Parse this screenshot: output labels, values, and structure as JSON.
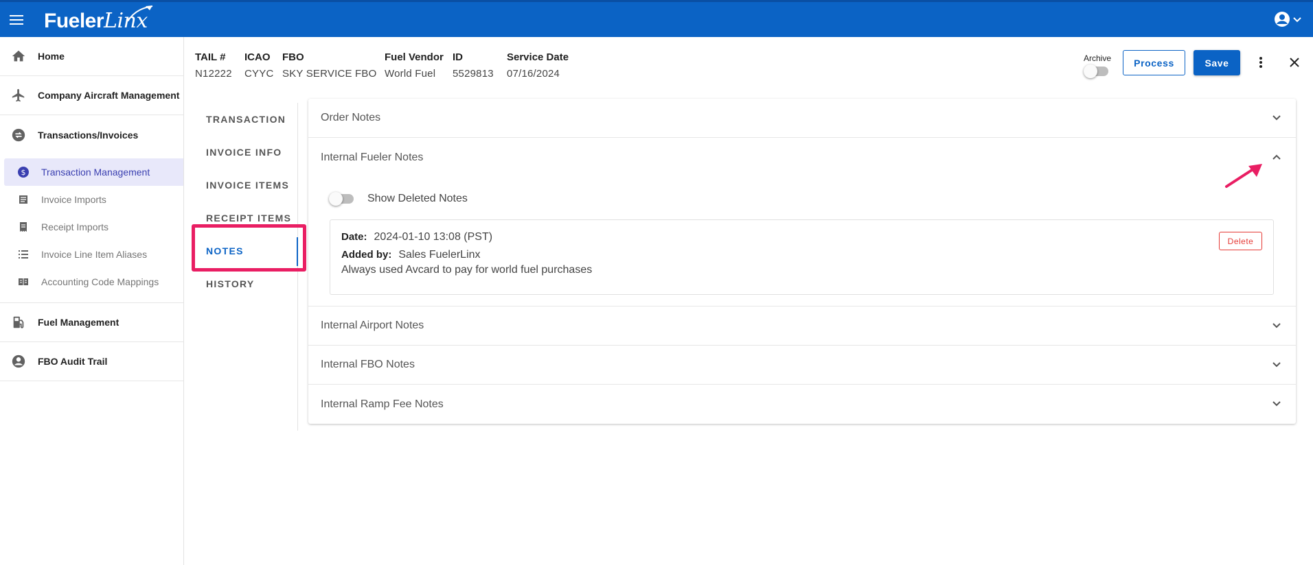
{
  "app": {
    "logo_main": "Fueler",
    "logo_accent": "Linx"
  },
  "sidebar": {
    "items": [
      {
        "label": "Home",
        "icon": "home-icon"
      },
      {
        "label": "Company Aircraft Management",
        "icon": "airplane-icon"
      },
      {
        "label": "Transactions/Invoices",
        "icon": "swap-icon"
      }
    ],
    "sub_items": [
      {
        "label": "Transaction Management",
        "icon": "dollar-circle-icon",
        "active": true
      },
      {
        "label": "Invoice Imports",
        "icon": "document-icon"
      },
      {
        "label": "Receipt Imports",
        "icon": "receipt-icon"
      },
      {
        "label": "Invoice Line Item Aliases",
        "icon": "list-icon"
      },
      {
        "label": "Accounting Code Mappings",
        "icon": "book-icon"
      }
    ],
    "bottom_items": [
      {
        "label": "Fuel Management",
        "icon": "fuel-pump-icon"
      },
      {
        "label": "FBO Audit Trail",
        "icon": "account-circle-icon"
      }
    ]
  },
  "header": {
    "fields": [
      {
        "label": "TAIL #",
        "value": "N12222"
      },
      {
        "label": "ICAO",
        "value": "CYYC"
      },
      {
        "label": "FBO",
        "value": "SKY SERVICE FBO"
      },
      {
        "label": "Fuel Vendor",
        "value": "World Fuel"
      },
      {
        "label": "ID",
        "value": "5529813"
      },
      {
        "label": "Service Date",
        "value": "07/16/2024"
      }
    ],
    "archive_label": "Archive",
    "archive_on": false,
    "process_label": "Process",
    "save_label": "Save"
  },
  "tabs": [
    {
      "label": "TRANSACTION"
    },
    {
      "label": "INVOICE INFO"
    },
    {
      "label": "INVOICE ITEMS"
    },
    {
      "label": "RECEIPT ITEMS"
    },
    {
      "label": "NOTES",
      "active": true
    },
    {
      "label": "HISTORY"
    }
  ],
  "panels": {
    "order_notes": "Order Notes",
    "internal_fueler_notes": "Internal Fueler Notes",
    "show_deleted_label": "Show Deleted Notes",
    "note": {
      "date_label": "Date:",
      "date_value": "2024-01-10 13:08 (PST)",
      "added_by_label": "Added by:",
      "added_by_value": "Sales FuelerLinx",
      "text": "Always used Avcard to pay for world fuel purchases",
      "delete_label": "Delete"
    },
    "internal_airport_notes": "Internal Airport Notes",
    "internal_fbo_notes": "Internal FBO Notes",
    "internal_ramp_fee_notes": "Internal Ramp Fee Notes"
  },
  "colors": {
    "brand_blue": "#0b63c5",
    "highlight_pink": "#e91e63",
    "delete_red": "#e53935",
    "active_nav_bg": "#e8e8fa"
  }
}
